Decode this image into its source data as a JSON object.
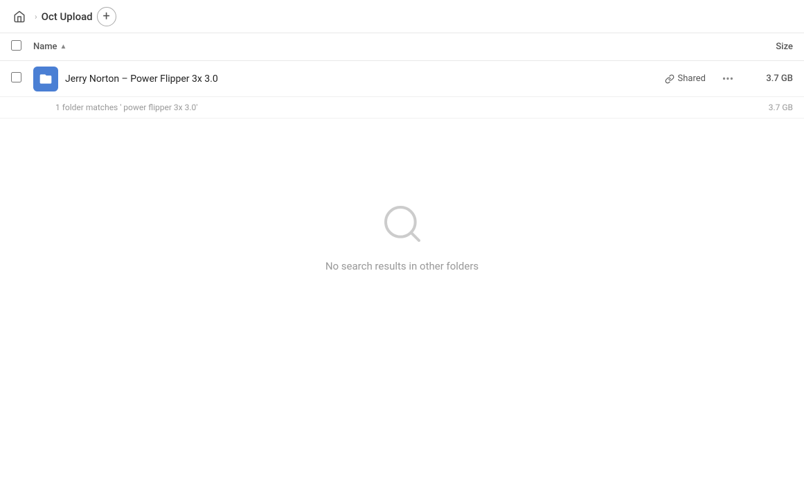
{
  "breadcrumb": {
    "home_label": "Home",
    "separator": "›",
    "folder_name": "Oct Upload",
    "add_button_label": "+"
  },
  "table_header": {
    "name_label": "Name",
    "sort_indicator": "▲",
    "size_label": "Size"
  },
  "file_row": {
    "name": "Jerry Norton – Power Flipper 3x 3.0",
    "shared_label": "Shared",
    "more_icon": "•••",
    "size": "3.7 GB"
  },
  "match_info": {
    "text": "1 folder matches ' power flipper 3x 3.0'",
    "size": "3.7 GB"
  },
  "empty_state": {
    "message": "No search results in other folders"
  },
  "icons": {
    "home": "⌂",
    "link": "🔗",
    "search": "🔍"
  }
}
